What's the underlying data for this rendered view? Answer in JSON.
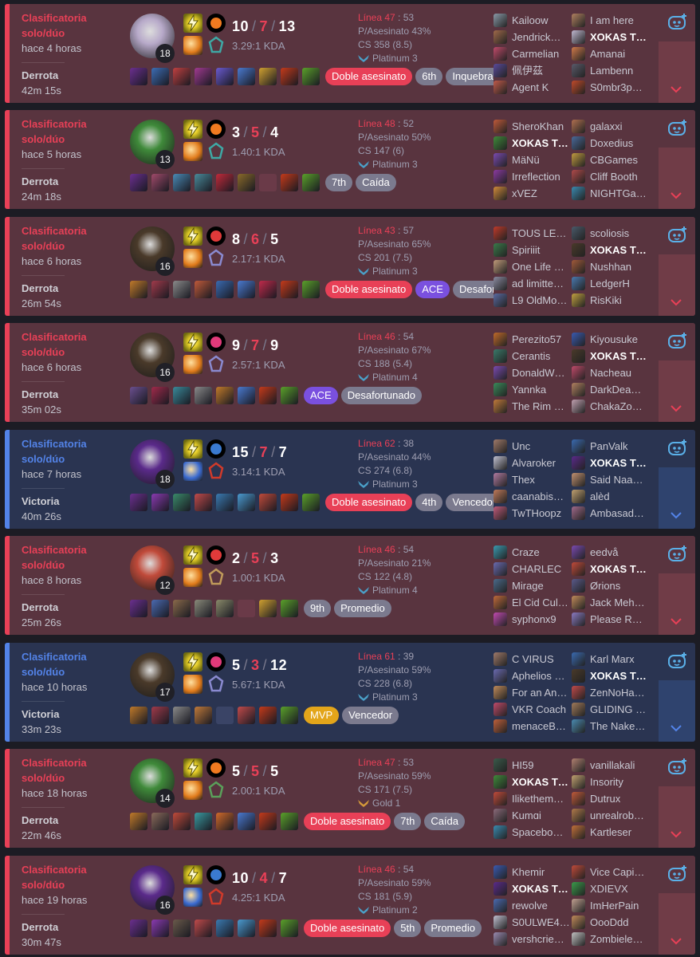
{
  "colors": {
    "loss_accent": "#e84057",
    "win_accent": "#5383e8",
    "loss_bg": "#59343f",
    "win_bg": "#2a3451"
  },
  "icons": {
    "summoner_spell_primary": "flash-spell-icon",
    "collapse": "chevron-down-icon",
    "ai_assistant": "bot-icon",
    "tier": "tier-wings-icon"
  },
  "matches": [
    {
      "queue": "Clasificatoria solo/dúo",
      "ago": "hace 4 horas",
      "result": "Derrota",
      "duration": "42m 15s",
      "outcome": "loss",
      "level": "18",
      "kills": "10",
      "deaths": "7",
      "assists": "13",
      "kda_ratio": "3.29:1 KDA",
      "pkill_label": "Línea 47",
      "pkill_num": "53",
      "kp": "P/Asesinato 43%",
      "cs": "CS 358 (8.5)",
      "tier": "Platinum 3",
      "champ_color": "#b7a9c9",
      "spell2_color": "#e07a1a",
      "rune_color": "#3ea8a5",
      "rune1_color": "#f07a20",
      "items": [
        "#6b2f8f",
        "#3c6db5",
        "#c04040",
        "#a03a90",
        "#6a5ad0",
        "#4a7ad0",
        "#d0a030",
        "#c43a1a",
        "#5aa02a"
      ],
      "tags": [
        {
          "label": "Doble asesinato",
          "kind": "red"
        },
        {
          "label": "6th",
          "kind": "gray"
        },
        {
          "label": "Inquebrantable",
          "kind": "gray"
        }
      ],
      "team1": [
        {
          "name": "Kailoow",
          "icon": "#8a9aa8"
        },
        {
          "name": "Jendrick…",
          "icon": "#a06a4a"
        },
        {
          "name": "Carmelian",
          "icon": "#c04a6a"
        },
        {
          "name": "佩伊茲",
          "icon": "#5a4a9a"
        },
        {
          "name": "Agent K",
          "icon": "#c05a4a"
        }
      ],
      "team2": [
        {
          "name": "I am here",
          "icon": "#b08060"
        },
        {
          "name": "XOKAS T…",
          "icon": "#c0b8d0",
          "me": true
        },
        {
          "name": "Amanai",
          "icon": "#d07a4a"
        },
        {
          "name": "Lambenn",
          "icon": "#5a5a6a"
        },
        {
          "name": "S0mbr3p…",
          "icon": "#c04a2a"
        }
      ]
    },
    {
      "queue": "Clasificatoria solo/dúo",
      "ago": "hace 5 horas",
      "result": "Derrota",
      "duration": "24m 18s",
      "outcome": "loss",
      "level": "13",
      "kills": "3",
      "deaths": "5",
      "assists": "4",
      "kda_ratio": "1.40:1 KDA",
      "pkill_label": "Línea 48",
      "pkill_num": "52",
      "kp": "P/Asesinato 50%",
      "cs": "CS 147 (6)",
      "tier": "Platinum 3",
      "champ_color": "#3f8a3a",
      "spell2_color": "#e07a1a",
      "rune_color": "#3ea8a5",
      "rune1_color": "#f07a20",
      "items": [
        "#6b2f8f",
        "#a04a6a",
        "#4a8ab5",
        "#4a8a9a",
        "#c02a3a",
        "#8a6a2a",
        "",
        "#c43a1a",
        "#5aa02a"
      ],
      "tags": [
        {
          "label": "7th",
          "kind": "gray"
        },
        {
          "label": "Caída",
          "kind": "gray"
        }
      ],
      "team1": [
        {
          "name": "SheroKhan",
          "icon": "#c05a3a"
        },
        {
          "name": "XOKAS T…",
          "icon": "#3f8a3a",
          "me": true
        },
        {
          "name": "MäNü",
          "icon": "#7a4ab0"
        },
        {
          "name": "Irreflection",
          "icon": "#8a3aa0"
        },
        {
          "name": "xVEZ",
          "icon": "#d08a3a"
        }
      ],
      "team2": [
        {
          "name": "galaxxi",
          "icon": "#b07050"
        },
        {
          "name": "Doxedius",
          "icon": "#4a6a9a"
        },
        {
          "name": "CBGames",
          "icon": "#c09a40"
        },
        {
          "name": "Cliff Booth",
          "icon": "#b04a4a"
        },
        {
          "name": "NIGHTGa…",
          "icon": "#3a8ab0"
        }
      ]
    },
    {
      "queue": "Clasificatoria solo/dúo",
      "ago": "hace 6 horas",
      "result": "Derrota",
      "duration": "26m 54s",
      "outcome": "loss",
      "level": "16",
      "kills": "8",
      "deaths": "6",
      "assists": "5",
      "kda_ratio": "2.17:1 KDA",
      "pkill_label": "Línea 43",
      "pkill_num": "57",
      "kp": "P/Asesinato 65%",
      "cs": "CS 201 (7.5)",
      "tier": "Platinum 3",
      "champ_color": "#4a3a2a",
      "spell2_color": "#e07a1a",
      "rune_color": "#8a8ad0",
      "rune1_color": "#e03a3a",
      "items": [
        "#c07a2a",
        "#a03a4a",
        "#8a8a8a",
        "#c05a3a",
        "#3a6ab0",
        "#4a7ad0",
        "#c02a4a",
        "#c43a1a",
        "#5aa02a"
      ],
      "tags": [
        {
          "label": "Doble asesinato",
          "kind": "red"
        },
        {
          "label": "ACE",
          "kind": "purple"
        },
        {
          "label": "Desafortunado",
          "kind": "gray"
        }
      ],
      "team1": [
        {
          "name": "TOUS LE…",
          "icon": "#c03a2a"
        },
        {
          "name": "Spiriiit",
          "icon": "#3a7a4a"
        },
        {
          "name": "One Life …",
          "icon": "#c09a7a"
        },
        {
          "name": "ad limitte…",
          "icon": "#8a8aa0"
        },
        {
          "name": "L9 OldMo…",
          "icon": "#5a6aa0"
        }
      ],
      "team2": [
        {
          "name": "scoliosis",
          "icon": "#4a5a6a"
        },
        {
          "name": "XOKAS T…",
          "icon": "#4a3a2a",
          "me": true
        },
        {
          "name": "Nushhan",
          "icon": "#a05a3a"
        },
        {
          "name": "LedgerH",
          "icon": "#4a7ab0"
        },
        {
          "name": "RisKiki",
          "icon": "#c0a040"
        }
      ]
    },
    {
      "queue": "Clasificatoria solo/dúo",
      "ago": "hace 6 horas",
      "result": "Derrota",
      "duration": "35m 02s",
      "outcome": "loss",
      "level": "16",
      "kills": "9",
      "deaths": "7",
      "assists": "9",
      "kda_ratio": "2.57:1 KDA",
      "pkill_label": "Línea 46",
      "pkill_num": "54",
      "kp": "P/Asesinato 67%",
      "cs": "CS 188 (5.4)",
      "tier": "Platinum 4",
      "champ_color": "#4a3a2a",
      "spell2_color": "#e07a1a",
      "rune_color": "#8a8ad0",
      "rune1_color": "#e03a7a",
      "items": [
        "#6b4f8f",
        "#a02a4a",
        "#3a8a9a",
        "#8a8a8a",
        "#c07a2a",
        "#4a7ad0",
        "#c43a1a",
        "#5aa02a"
      ],
      "tags": [
        {
          "label": "ACE",
          "kind": "purple"
        },
        {
          "label": "Desafortunado",
          "kind": "gray"
        }
      ],
      "team1": [
        {
          "name": "Perezito57",
          "icon": "#c06a2a"
        },
        {
          "name": "Cerantis",
          "icon": "#3a7a6a"
        },
        {
          "name": "DonaldW…",
          "icon": "#7a4ab0"
        },
        {
          "name": "Yannka",
          "icon": "#3a8a5a"
        },
        {
          "name": "The Rim …",
          "icon": "#c07a3a"
        }
      ],
      "team2": [
        {
          "name": "Kiyousuke",
          "icon": "#3a5ab0"
        },
        {
          "name": "XOKAS T…",
          "icon": "#4a3a2a",
          "me": true
        },
        {
          "name": "Nacheau",
          "icon": "#c04a6a"
        },
        {
          "name": "DarkDea…",
          "icon": "#b08060"
        },
        {
          "name": "ChakaZo…",
          "icon": "#c0a0b0"
        }
      ]
    },
    {
      "queue": "Clasificatoria solo/dúo",
      "ago": "hace 7 horas",
      "result": "Victoria",
      "duration": "40m 26s",
      "outcome": "win",
      "level": "18",
      "kills": "15",
      "deaths": "7",
      "assists": "7",
      "kda_ratio": "3.14:1 KDA",
      "pkill_label": "Línea 62",
      "pkill_num": "38",
      "kp": "P/Asesinato 44%",
      "cs": "CS 274 (6.8)",
      "tier": "Platinum 3",
      "champ_color": "#5a2a8a",
      "spell2_color": "#3a6ad0",
      "rune_color": "#d03a2a",
      "rune1_color": "#3a7ad0",
      "items": [
        "#6b2f8f",
        "#8a3ab0",
        "#3a8a6a",
        "#c04a4a",
        "#3a7ab0",
        "#4a9ad0",
        "#c04a3a",
        "#c43a1a",
        "#5aa02a"
      ],
      "tags": [
        {
          "label": "Doble asesinato",
          "kind": "red"
        },
        {
          "label": "4th",
          "kind": "gray"
        },
        {
          "label": "Vencedor",
          "kind": "gray"
        }
      ],
      "team1": [
        {
          "name": "Unc",
          "icon": "#a07a6a"
        },
        {
          "name": "Alvaroker",
          "icon": "#c0c0d0"
        },
        {
          "name": "Thex",
          "icon": "#b07aa0"
        },
        {
          "name": "caanabis…",
          "icon": "#c07a5a"
        },
        {
          "name": "TwTHoopz",
          "icon": "#c05a7a"
        }
      ],
      "team2": [
        {
          "name": "PanValk",
          "icon": "#3a6ab0"
        },
        {
          "name": "XOKAS T…",
          "icon": "#5a2a8a",
          "me": true
        },
        {
          "name": "Said Naa…",
          "icon": "#c09070"
        },
        {
          "name": "alèd",
          "icon": "#c0a070"
        },
        {
          "name": "Ambasad…",
          "icon": "#a06a8a"
        }
      ]
    },
    {
      "queue": "Clasificatoria solo/dúo",
      "ago": "hace 8 horas",
      "result": "Derrota",
      "duration": "25m 26s",
      "outcome": "loss",
      "level": "12",
      "kills": "2",
      "deaths": "5",
      "assists": "3",
      "kda_ratio": "1.00:1 KDA",
      "pkill_label": "Línea 46",
      "pkill_num": "54",
      "kp": "P/Asesinato 21%",
      "cs": "CS 122 (4.8)",
      "tier": "Platinum 4",
      "champ_color": "#c04a3a",
      "spell2_color": "#e07a1a",
      "rune_color": "#c09a5a",
      "rune1_color": "#e03a3a",
      "items": [
        "#6b2f8f",
        "#4a6ab0",
        "#8a6a4a",
        "#8a8a7a",
        "#8a8a6a",
        "",
        "#d0a030",
        "#5aa02a"
      ],
      "tags": [
        {
          "label": "9th",
          "kind": "gray"
        },
        {
          "label": "Promedio",
          "kind": "gray"
        }
      ],
      "team1": [
        {
          "name": "Craze",
          "icon": "#3a9ab0"
        },
        {
          "name": "CHARLEC",
          "icon": "#6a6ab0"
        },
        {
          "name": "Mirage",
          "icon": "#4a6a8a"
        },
        {
          "name": "El Cid Cul…",
          "icon": "#c06a3a"
        },
        {
          "name": "syphonx9",
          "icon": "#c04ab0"
        }
      ],
      "team2": [
        {
          "name": "eedvå",
          "icon": "#7a4ab0"
        },
        {
          "name": "XOKAS T…",
          "icon": "#c04a3a",
          "me": true
        },
        {
          "name": "Ørions",
          "icon": "#5a5a8a"
        },
        {
          "name": "Jack Meh…",
          "icon": "#c08a5a"
        },
        {
          "name": "Please R…",
          "icon": "#8a7ac0"
        }
      ]
    },
    {
      "queue": "Clasificatoria solo/dúo",
      "ago": "hace 10 horas",
      "result": "Victoria",
      "duration": "33m 23s",
      "outcome": "win",
      "level": "17",
      "kills": "5",
      "deaths": "3",
      "assists": "12",
      "kda_ratio": "5.67:1 KDA",
      "pkill_label": "Línea 61",
      "pkill_num": "39",
      "kp": "P/Asesinato 59%",
      "cs": "CS 228 (6.8)",
      "tier": "Platinum 3",
      "champ_color": "#4a3a2a",
      "spell2_color": "#e07a1a",
      "rune_color": "#8a8ad0",
      "rune1_color": "#e03a7a",
      "items": [
        "#c07a2a",
        "#a03a4a",
        "#8a8a8a",
        "#c07a3a",
        "",
        "#c04a4a",
        "#c43a1a",
        "#5aa02a"
      ],
      "tags": [
        {
          "label": "MVP",
          "kind": "gold"
        },
        {
          "label": "Vencedor",
          "kind": "gray"
        }
      ],
      "team1": [
        {
          "name": "C VIRUS",
          "icon": "#a07a6a"
        },
        {
          "name": "Aphelios …",
          "icon": "#6a6ab0"
        },
        {
          "name": "For an An…",
          "icon": "#c08a5a"
        },
        {
          "name": "VKR Coach",
          "icon": "#c04a6a"
        },
        {
          "name": "menaceB…",
          "icon": "#c0603a"
        }
      ],
      "team2": [
        {
          "name": "Karl Marx",
          "icon": "#3a6ab0"
        },
        {
          "name": "XOKAS T…",
          "icon": "#4a3a2a",
          "me": true
        },
        {
          "name": "ZenNoHa…",
          "icon": "#c04a4a"
        },
        {
          "name": "GLIDING …",
          "icon": "#a07a5a"
        },
        {
          "name": "The Nake…",
          "icon": "#4a8ab0"
        }
      ]
    },
    {
      "queue": "Clasificatoria solo/dúo",
      "ago": "hace 18 horas",
      "result": "Derrota",
      "duration": "22m 46s",
      "outcome": "loss",
      "level": "14",
      "kills": "5",
      "deaths": "5",
      "assists": "5",
      "kda_ratio": "2.00:1 KDA",
      "pkill_label": "Línea 47",
      "pkill_num": "53",
      "kp": "P/Asesinato 59%",
      "cs": "CS 171 (7.5)",
      "tier": "Gold 1",
      "champ_color": "#3f8a3a",
      "spell2_color": "#e07a1a",
      "rune_color": "#5aa05a",
      "rune1_color": "#f07a20",
      "items": [
        "#c07a2a",
        "#8a6a5a",
        "#c04a3a",
        "#3a9aa0",
        "#d06a2a",
        "#4a7ad0",
        "#c43a1a",
        "#5aa02a"
      ],
      "tags": [
        {
          "label": "Doble asesinato",
          "kind": "red"
        },
        {
          "label": "7th",
          "kind": "gray"
        },
        {
          "label": "Caída",
          "kind": "gray"
        }
      ],
      "team1": [
        {
          "name": "HI59",
          "icon": "#3a5a4a"
        },
        {
          "name": "XOKAS T…",
          "icon": "#3f8a3a",
          "me": true
        },
        {
          "name": "Ilikethem…",
          "icon": "#c04a3a"
        },
        {
          "name": "Kumɑi",
          "icon": "#8a6a7a"
        },
        {
          "name": "Spacebo…",
          "icon": "#3a8ab0"
        }
      ],
      "team2": [
        {
          "name": "vanillakali",
          "icon": "#b08070"
        },
        {
          "name": "Insority",
          "icon": "#c0a070"
        },
        {
          "name": "Dutrux",
          "icon": "#c05a3a"
        },
        {
          "name": "unrealrob…",
          "icon": "#b07a4a"
        },
        {
          "name": "Kartleser",
          "icon": "#c0703a"
        }
      ]
    },
    {
      "queue": "Clasificatoria solo/dúo",
      "ago": "hace 19 horas",
      "result": "Derrota",
      "duration": "30m 47s",
      "outcome": "loss",
      "level": "16",
      "kills": "10",
      "deaths": "4",
      "assists": "7",
      "kda_ratio": "4.25:1 KDA",
      "pkill_label": "Línea 46",
      "pkill_num": "54",
      "kp": "P/Asesinato 59%",
      "cs": "CS 181 (5.9)",
      "tier": "Platinum 2",
      "champ_color": "#5a2a8a",
      "spell2_color": "#3a6ad0",
      "rune_color": "#d03a2a",
      "rune1_color": "#3a7ad0",
      "items": [
        "#6b2f8f",
        "#8a3ab0",
        "#6a5a4a",
        "#c04a4a",
        "#3a7ab0",
        "#4a9ad0",
        "#c43a1a",
        "#5aa02a"
      ],
      "tags": [
        {
          "label": "Doble asesinato",
          "kind": "red"
        },
        {
          "label": "5th",
          "kind": "gray"
        },
        {
          "label": "Promedio",
          "kind": "gray"
        }
      ],
      "team1": [
        {
          "name": "Khemir",
          "icon": "#3a5ab0"
        },
        {
          "name": "XOKAS T…",
          "icon": "#5a2a8a",
          "me": true
        },
        {
          "name": "rewolve",
          "icon": "#4a6ab0"
        },
        {
          "name": "S0ULWE4…",
          "icon": "#c0c0d0"
        },
        {
          "name": "vershcrie…",
          "icon": "#9a8ab0"
        }
      ],
      "team2": [
        {
          "name": "Vice Capi…",
          "icon": "#c04a3a"
        },
        {
          "name": "XDIEVX",
          "icon": "#3a9a4a"
        },
        {
          "name": "ImHerPain",
          "icon": "#c0a090"
        },
        {
          "name": "OooDdd",
          "icon": "#c08a5a"
        },
        {
          "name": "Zombiele…",
          "icon": "#c0c0c0"
        }
      ]
    }
  ]
}
